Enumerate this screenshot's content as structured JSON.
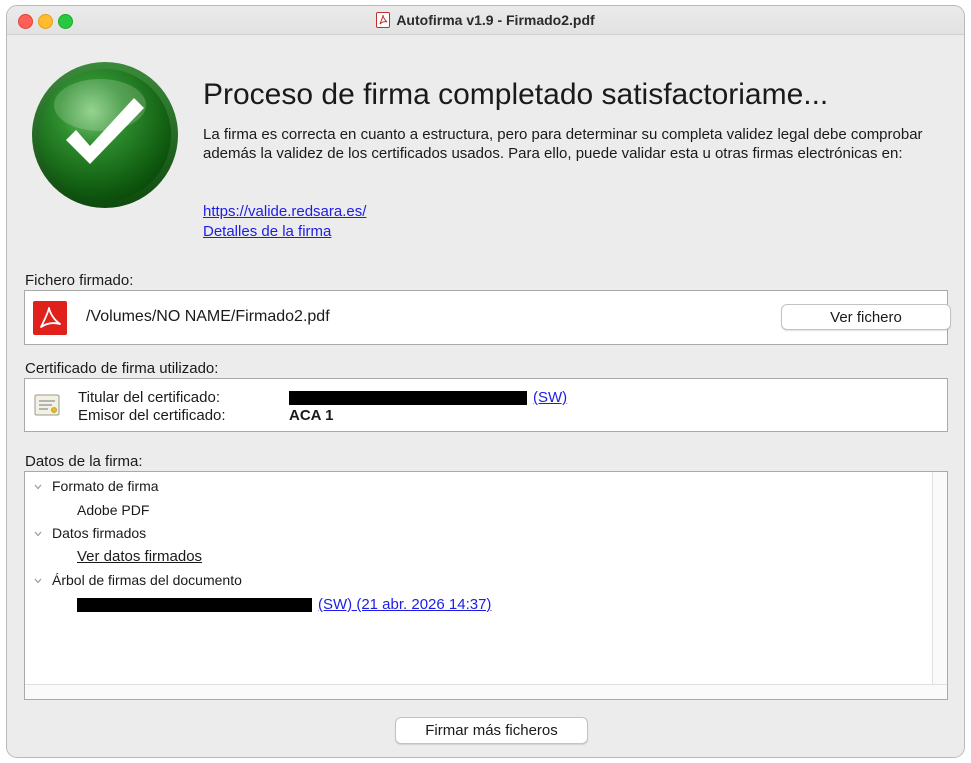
{
  "window": {
    "title": "Autofirma v1.9 - Firmado2.pdf"
  },
  "header": {
    "title": "Proceso de firma completado satisfactoriame...",
    "description": "La firma es correcta en cuanto a estructura, pero para determinar su completa validez legal debe comprobar además la validez de los certificados usados. Para ello, puede validar esta u otras firmas electrónicas en:",
    "link_valide": "https://valide.redsara.es/",
    "link_detalles": "Detalles de la firma"
  },
  "file_section": {
    "label": "Fichero firmado:",
    "path": "/Volumes/NO NAME/Firmado2.pdf",
    "view_button": "Ver fichero"
  },
  "cert_section": {
    "label": "Certificado de firma utilizado:",
    "holder_label": "Titular del certificado:",
    "holder_value_suffix": "(SW)",
    "issuer_label": "Emisor del certificado:",
    "issuer_value": "ACA 1"
  },
  "data_section": {
    "label": "Datos de la firma:",
    "tree": {
      "format_label": "Formato de firma",
      "format_value": "Adobe PDF",
      "signed_data_label": "Datos firmados",
      "signed_data_link": "Ver datos firmados",
      "signature_tree_label": "Árbol de firmas del documento",
      "signature_tree_suffix": "(SW) (21 abr. 2026 14:37)"
    }
  },
  "footer": {
    "sign_more_button": "Firmar más ficheros"
  },
  "colors": {
    "link": "#1d1de6",
    "success_green": "#1f7a1f",
    "pdf_red": "#e0211b"
  },
  "icons": {
    "title_icon": "pdf-file-icon",
    "big_icon": "success-check-icon",
    "file_icon": "pdf-icon",
    "cert_icon": "certificate-icon",
    "tree_toggle": "chevron-down-icon"
  }
}
